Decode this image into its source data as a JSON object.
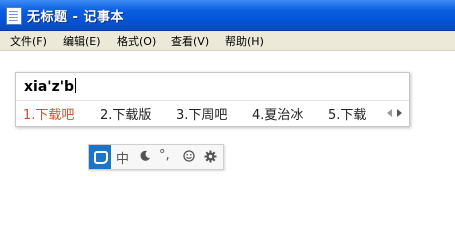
{
  "window": {
    "title": "无标题 - 记事本",
    "app_icon": "notepad-icon"
  },
  "menu": {
    "items": [
      {
        "label": "文件(F)"
      },
      {
        "label": "编辑(E)"
      },
      {
        "label": "格式(O)"
      },
      {
        "label": "查看(V)"
      },
      {
        "label": "帮助(H)"
      }
    ]
  },
  "ime": {
    "composition": "xia'z'b",
    "candidates": [
      {
        "label": "1.下载吧",
        "selected": true
      },
      {
        "label": "2.下载版"
      },
      {
        "label": "3.下周吧"
      },
      {
        "label": "4.夏治冰"
      },
      {
        "label": "5.下载"
      }
    ],
    "selected_color": "#d0502a",
    "page_nav_icons": [
      "prev-page-icon",
      "next-page-icon"
    ]
  },
  "ime_status": {
    "logo_icon": "ime-logo-icon",
    "mode_label": "中",
    "width_icon": "half-width-moon-icon",
    "punct_label": "°,",
    "emoji_icon": "smiley-icon",
    "settings_icon": "gear-icon"
  },
  "colors": {
    "titlebar": "#0553d6",
    "menubar": "#ece9d8",
    "ime_logo_bg": "#1d75c8"
  }
}
